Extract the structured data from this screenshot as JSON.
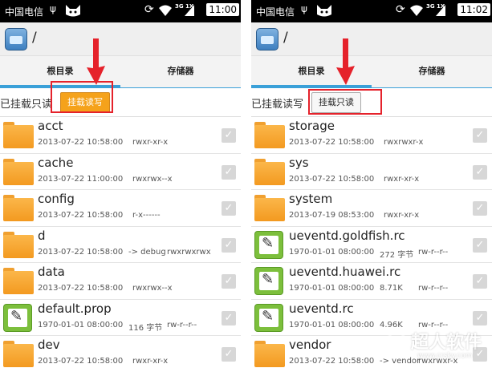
{
  "colors": {
    "accent": "#3aa0d8",
    "button_active": "#f5a21b",
    "highlight": "#e5222b",
    "folder": "#f5a42a",
    "file_icon": "#7cbf3c"
  },
  "status_left": {
    "carrier": "中国电信",
    "net": "3G 1X",
    "time": "11:00"
  },
  "status_right": {
    "carrier": "中国电信",
    "net": "3G 1X",
    "time": "11:02"
  },
  "path": "/",
  "tabs": [
    "根目录",
    "存储器"
  ],
  "left": {
    "mount_status": "已挂载只读",
    "mount_button": "挂载读写",
    "files": [
      {
        "name": "acct",
        "date": "2013-07-22 10:58:00",
        "size": "",
        "perm": "rwxr-xr-x",
        "type": "folder"
      },
      {
        "name": "cache",
        "date": "2013-07-22 11:00:00",
        "size": "",
        "perm": "rwxrwx--x",
        "type": "folder"
      },
      {
        "name": "config",
        "date": "2013-07-22 10:58:00",
        "size": "",
        "perm": "r-x------",
        "type": "folder"
      },
      {
        "name": "d",
        "date": "2013-07-22 10:58:00",
        "size": "-> debug",
        "perm": "rwxrwxrwx",
        "type": "folder"
      },
      {
        "name": "data",
        "date": "2013-07-22 10:58:00",
        "size": "",
        "perm": "rwxrwx--x",
        "type": "folder"
      },
      {
        "name": "default.prop",
        "date": "1970-01-01 08:00:00",
        "size": "116 字节",
        "perm": "rw-r--r--",
        "type": "file"
      },
      {
        "name": "dev",
        "date": "2013-07-22 10:58:00",
        "size": "",
        "perm": "rwxr-xr-x",
        "type": "folder"
      }
    ]
  },
  "right": {
    "mount_status": "已挂载读写",
    "mount_button": "挂载只读",
    "files": [
      {
        "name": "storage",
        "date": "2013-07-22 10:58:00",
        "size": "",
        "perm": "rwxrwxr-x",
        "type": "folder"
      },
      {
        "name": "sys",
        "date": "2013-07-22 10:58:00",
        "size": "",
        "perm": "rwxr-xr-x",
        "type": "folder"
      },
      {
        "name": "system",
        "date": "2013-07-19 08:53:00",
        "size": "",
        "perm": "rwxr-xr-x",
        "type": "folder"
      },
      {
        "name": "ueventd.goldfish.rc",
        "date": "1970-01-01 08:00:00",
        "size": "272 字节",
        "perm": "rw-r--r--",
        "type": "file"
      },
      {
        "name": "ueventd.huawei.rc",
        "date": "1970-01-01 08:00:00",
        "size": "8.71K",
        "perm": "rw-r--r--",
        "type": "file"
      },
      {
        "name": "ueventd.rc",
        "date": "1970-01-01 08:00:00",
        "size": "4.96K",
        "perm": "rw-r--r--",
        "type": "file"
      },
      {
        "name": "vendor",
        "date": "2013-07-22 10:58:00",
        "size": "-> vendor",
        "perm": "rwxrwxr-x",
        "type": "folder"
      }
    ]
  },
  "watermark": {
    "text": "超人软件",
    "url": "www.crsky.com"
  }
}
